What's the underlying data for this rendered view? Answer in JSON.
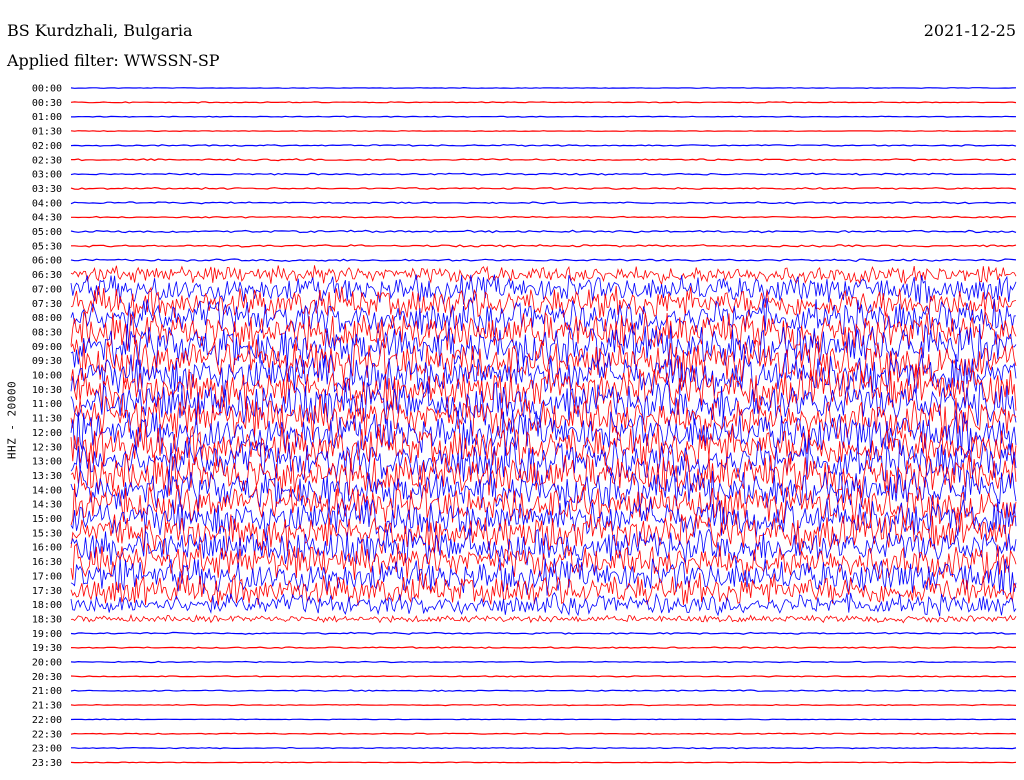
{
  "header": {
    "station": "BS Kurdzhali, Bulgaria",
    "date": "2021-12-25",
    "filter": "Applied filter: WWSSN-SP"
  },
  "chart_data": {
    "type": "line",
    "ylabel": "HHZ - 20000",
    "colors": {
      "even_hour_trace": "#0000ff",
      "half_hour_trace": "#ff0000"
    },
    "rows": [
      {
        "time": "00:00",
        "amplitude": 0.4
      },
      {
        "time": "00:30",
        "amplitude": 0.6
      },
      {
        "time": "01:00",
        "amplitude": 0.5
      },
      {
        "time": "01:30",
        "amplitude": 0.4
      },
      {
        "time": "02:00",
        "amplitude": 0.8
      },
      {
        "time": "02:30",
        "amplitude": 1.0
      },
      {
        "time": "03:00",
        "amplitude": 1.0
      },
      {
        "time": "03:30",
        "amplitude": 1.0
      },
      {
        "time": "04:00",
        "amplitude": 1.0
      },
      {
        "time": "04:30",
        "amplitude": 0.8
      },
      {
        "time": "05:00",
        "amplitude": 1.3
      },
      {
        "time": "05:30",
        "amplitude": 1.2
      },
      {
        "time": "06:00",
        "amplitude": 1.3
      },
      {
        "time": "06:30",
        "amplitude": 10
      },
      {
        "time": "07:00",
        "amplitude": 16
      },
      {
        "time": "07:30",
        "amplitude": 18
      },
      {
        "time": "08:00",
        "amplitude": 20
      },
      {
        "time": "08:30",
        "amplitude": 22
      },
      {
        "time": "09:00",
        "amplitude": 24
      },
      {
        "time": "09:30",
        "amplitude": 24
      },
      {
        "time": "10:00",
        "amplitude": 24
      },
      {
        "time": "10:30",
        "amplitude": 24
      },
      {
        "time": "11:00",
        "amplitude": 24
      },
      {
        "time": "11:30",
        "amplitude": 24
      },
      {
        "time": "12:00",
        "amplitude": 24
      },
      {
        "time": "12:30",
        "amplitude": 24
      },
      {
        "time": "13:00",
        "amplitude": 24
      },
      {
        "time": "13:30",
        "amplitude": 24
      },
      {
        "time": "14:00",
        "amplitude": 22
      },
      {
        "time": "14:30",
        "amplitude": 22
      },
      {
        "time": "15:00",
        "amplitude": 22
      },
      {
        "time": "15:30",
        "amplitude": 22
      },
      {
        "time": "16:00",
        "amplitude": 20
      },
      {
        "time": "16:30",
        "amplitude": 20
      },
      {
        "time": "17:00",
        "amplitude": 20
      },
      {
        "time": "17:30",
        "amplitude": 18
      },
      {
        "time": "18:00",
        "amplitude": 12
      },
      {
        "time": "18:30",
        "amplitude": 4
      },
      {
        "time": "19:00",
        "amplitude": 1.0
      },
      {
        "time": "19:30",
        "amplitude": 0.8
      },
      {
        "time": "20:00",
        "amplitude": 0.6
      },
      {
        "time": "20:30",
        "amplitude": 0.6
      },
      {
        "time": "21:00",
        "amplitude": 0.8
      },
      {
        "time": "21:30",
        "amplitude": 0.6
      },
      {
        "time": "22:00",
        "amplitude": 0.4
      },
      {
        "time": "22:30",
        "amplitude": 0.6
      },
      {
        "time": "23:00",
        "amplitude": 0.6
      },
      {
        "time": "23:30",
        "amplitude": 0.4
      }
    ]
  }
}
